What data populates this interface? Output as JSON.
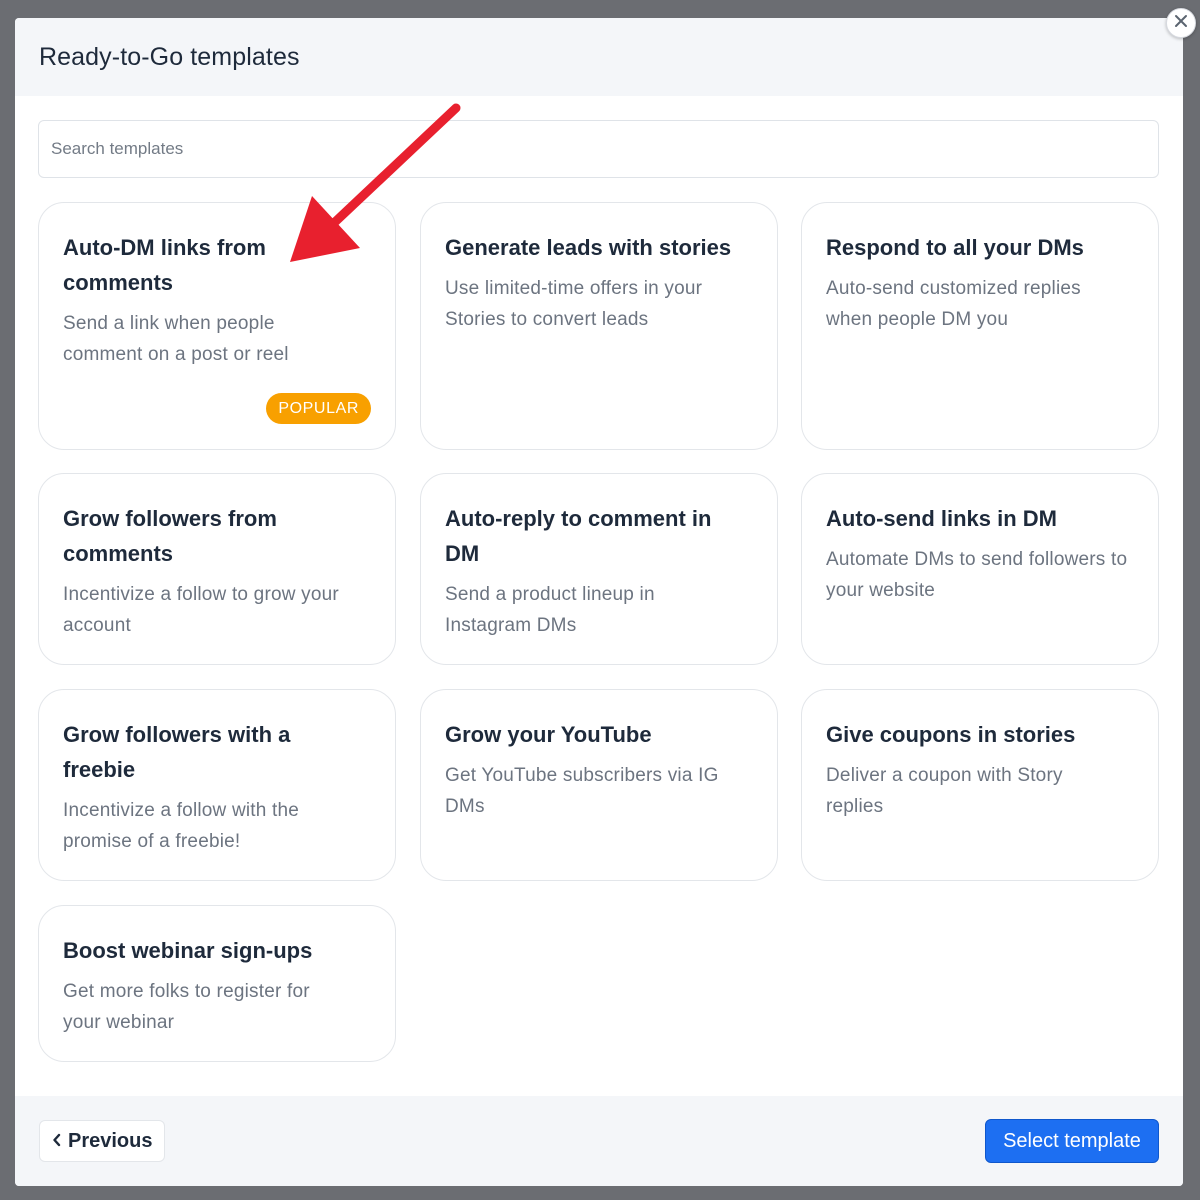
{
  "modal": {
    "title": "Ready-to-Go templates",
    "close_icon": "close-icon"
  },
  "search": {
    "placeholder": "Search templates",
    "value": ""
  },
  "templates": [
    {
      "title": "Auto-DM links from comments",
      "description": "Send a link when people comment on a post or reel",
      "badge": "POPULAR"
    },
    {
      "title": "Generate leads with stories",
      "description": "Use limited-time offers in your Stories to convert leads"
    },
    {
      "title": "Respond to all your DMs",
      "description": "Auto-send customized replies when people DM you"
    },
    {
      "title": "Grow followers from comments",
      "description": "Incentivize a follow to grow your account"
    },
    {
      "title": "Auto-reply to comment in DM",
      "description": "Send a product lineup in Instagram DMs"
    },
    {
      "title": "Auto-send links in DM",
      "description": "Automate DMs to send followers to your website"
    },
    {
      "title": "Grow followers with a freebie",
      "description": "Incentivize a follow with the promise of a freebie!"
    },
    {
      "title": "Grow your YouTube",
      "description": "Get YouTube subscribers via IG DMs"
    },
    {
      "title": "Give coupons in stories",
      "description": "Deliver a coupon with Story replies"
    },
    {
      "title": "Boost webinar sign-ups",
      "description": "Get more folks to register for your webinar"
    }
  ],
  "footer": {
    "previous_label": "Previous",
    "select_label": "Select template"
  },
  "colors": {
    "accent": "#1d6ff2",
    "badge": "#f8a000",
    "annotation_arrow": "#e8202e"
  },
  "icons": {
    "close": "close-icon",
    "previous": "chevron-left-icon",
    "annotation": "red-arrow-icon"
  }
}
